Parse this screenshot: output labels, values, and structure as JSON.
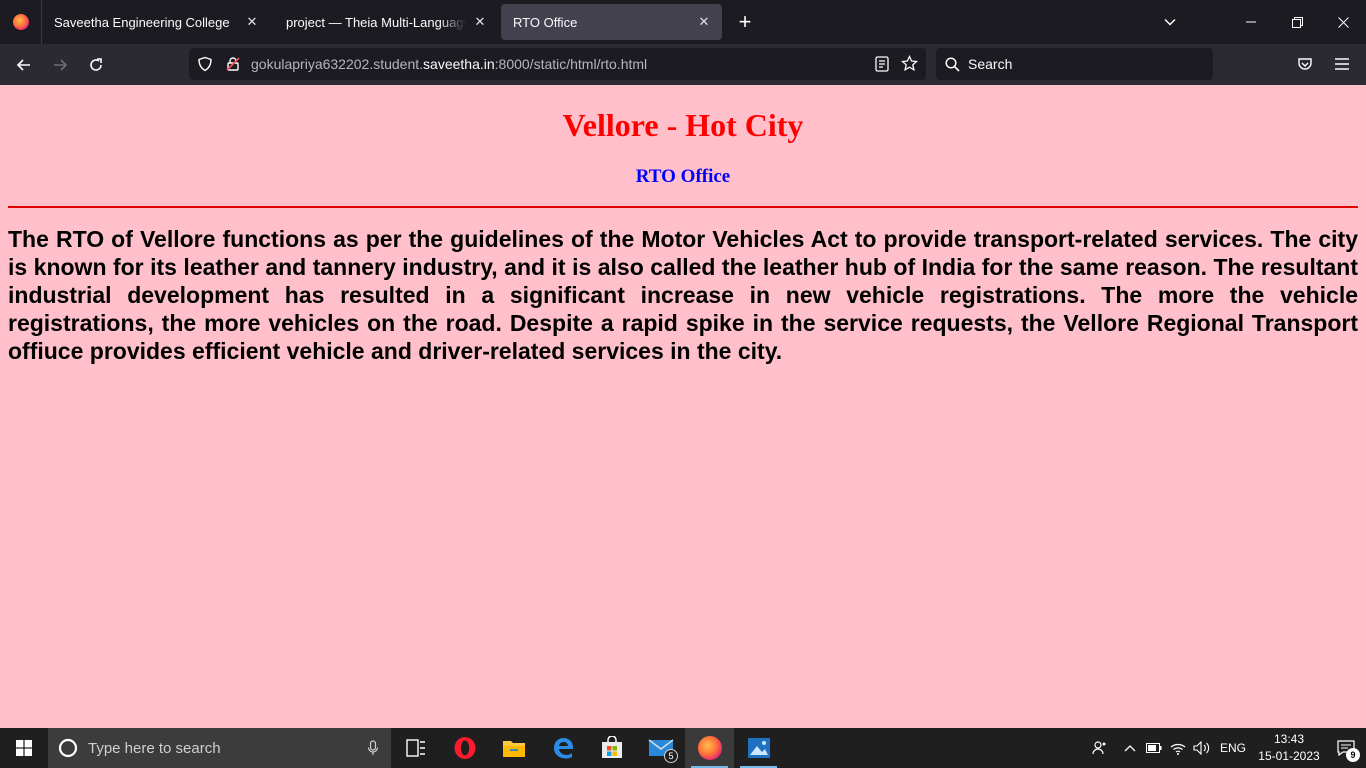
{
  "browser": {
    "tabs": [
      {
        "label": "Saveetha Engineering College",
        "active": false
      },
      {
        "label": "project — Theia Multi-Language Explorer",
        "active": false
      },
      {
        "label": "RTO Office",
        "active": true
      }
    ],
    "url": {
      "prefix": "gokulapriya632202.student.",
      "domain": "saveetha.in",
      "suffix": ":8000/static/html/rto.html"
    },
    "search_placeholder": "Search"
  },
  "page": {
    "heading": "Vellore - Hot City",
    "subheading": "RTO Office",
    "paragraph": "The RTO of Vellore functions as per the guidelines of the Motor Vehicles Act to provide transport-related services. The city is known for its leather and tannery industry, and it is also called the leather hub of India for the same reason. The resultant industrial development has resulted in a significant increase in new vehicle registrations. The more the vehicle registrations, the more vehicles on the road. Despite a rapid spike in the service requests, the Vellore Regional Transport offiuce provides efficient vehicle and driver-related services in the city.",
    "background_color": "#ffc0cb",
    "heading_color": "#ff0000",
    "subheading_color": "#0000ff"
  },
  "taskbar": {
    "search_placeholder": "Type here to search",
    "mail_badge": "5",
    "language": "ENG",
    "time": "13:43",
    "date": "15-01-2023",
    "notification_count": "9"
  }
}
